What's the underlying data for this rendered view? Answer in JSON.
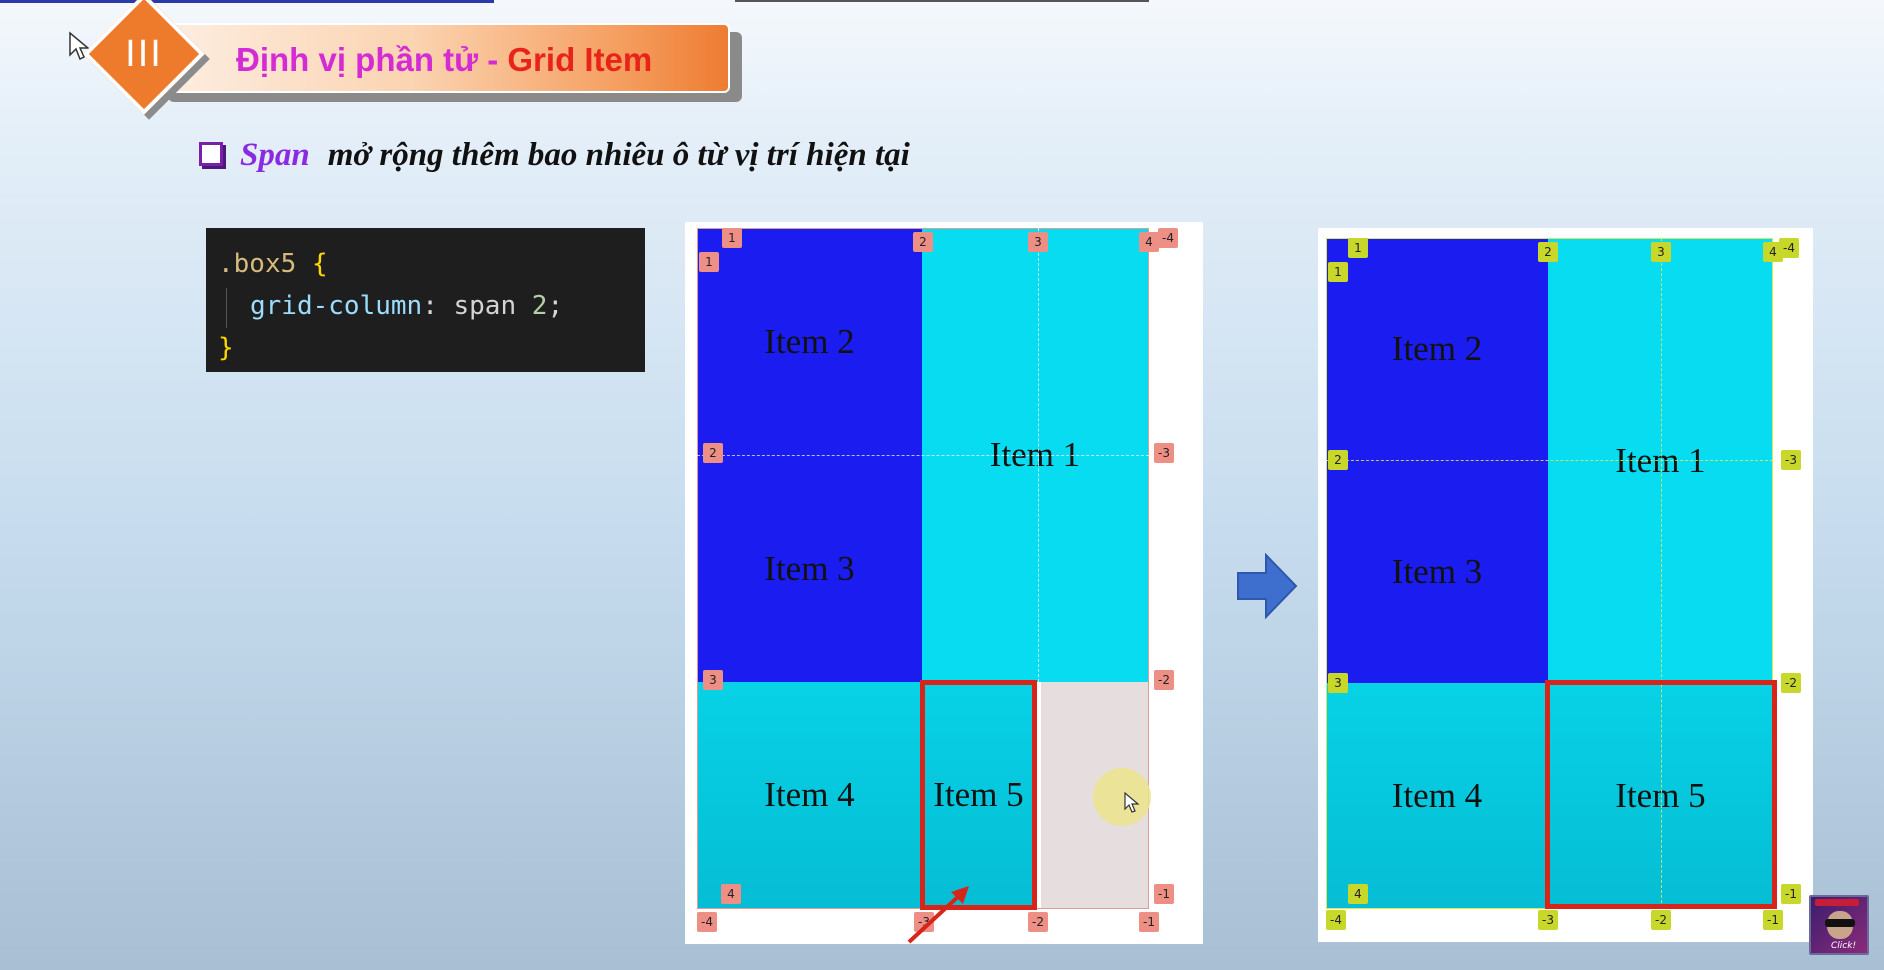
{
  "slide": {
    "section_number": "III",
    "title_part_a": "Định vị phần tử - ",
    "title_part_b": "Grid Item",
    "subtitle_keyword": "Span",
    "subtitle_text": "mở rộng thêm bao nhiêu ô từ vị trí hiện tại"
  },
  "code": {
    "selector": ".box5",
    "open_brace": "{",
    "property": "grid-column",
    "colon": ":",
    "value_keyword": "span",
    "value_number": "2",
    "semicolon": ";",
    "close_brace": "}"
  },
  "grid_before": {
    "items": {
      "item1": "Item 1",
      "item2": "Item 2",
      "item3": "Item 3",
      "item4": "Item 4",
      "item5": "Item 5"
    },
    "line_labels": {
      "top": [
        "1",
        "2",
        "3",
        "4"
      ],
      "top_right": "-4",
      "left_row1": "1",
      "left": [
        "2",
        "3"
      ],
      "left_bottom": "4",
      "right": [
        "-3",
        "-2",
        "-1"
      ],
      "bottom": [
        "-4",
        "-3",
        "-2",
        "-1"
      ]
    }
  },
  "grid_after": {
    "items": {
      "item1": "Item 1",
      "item2": "Item 2",
      "item3": "Item 3",
      "item4": "Item 4",
      "item5": "Item 5"
    },
    "line_labels": {
      "top": [
        "1",
        "2",
        "3",
        "4"
      ],
      "top_right": "-4",
      "left_row1": "1",
      "left": [
        "2",
        "3"
      ],
      "left_bottom": "4",
      "right": [
        "-3",
        "-2",
        "-1"
      ],
      "bottom": [
        "-4",
        "-3",
        "-2",
        "-1"
      ]
    }
  },
  "overlay": {
    "channel_badge": "Click!",
    "transition_arrow": "arrow-right-icon"
  },
  "colors": {
    "item_blue": "#1a1cf0",
    "item_cyan": "#07dcf0",
    "highlight_red": "#d8251a",
    "banner_orange": "#ee7a2c",
    "title_magenta": "#d42bd4",
    "title_red": "#e8231a",
    "keyword_purple": "#8a2be2"
  }
}
